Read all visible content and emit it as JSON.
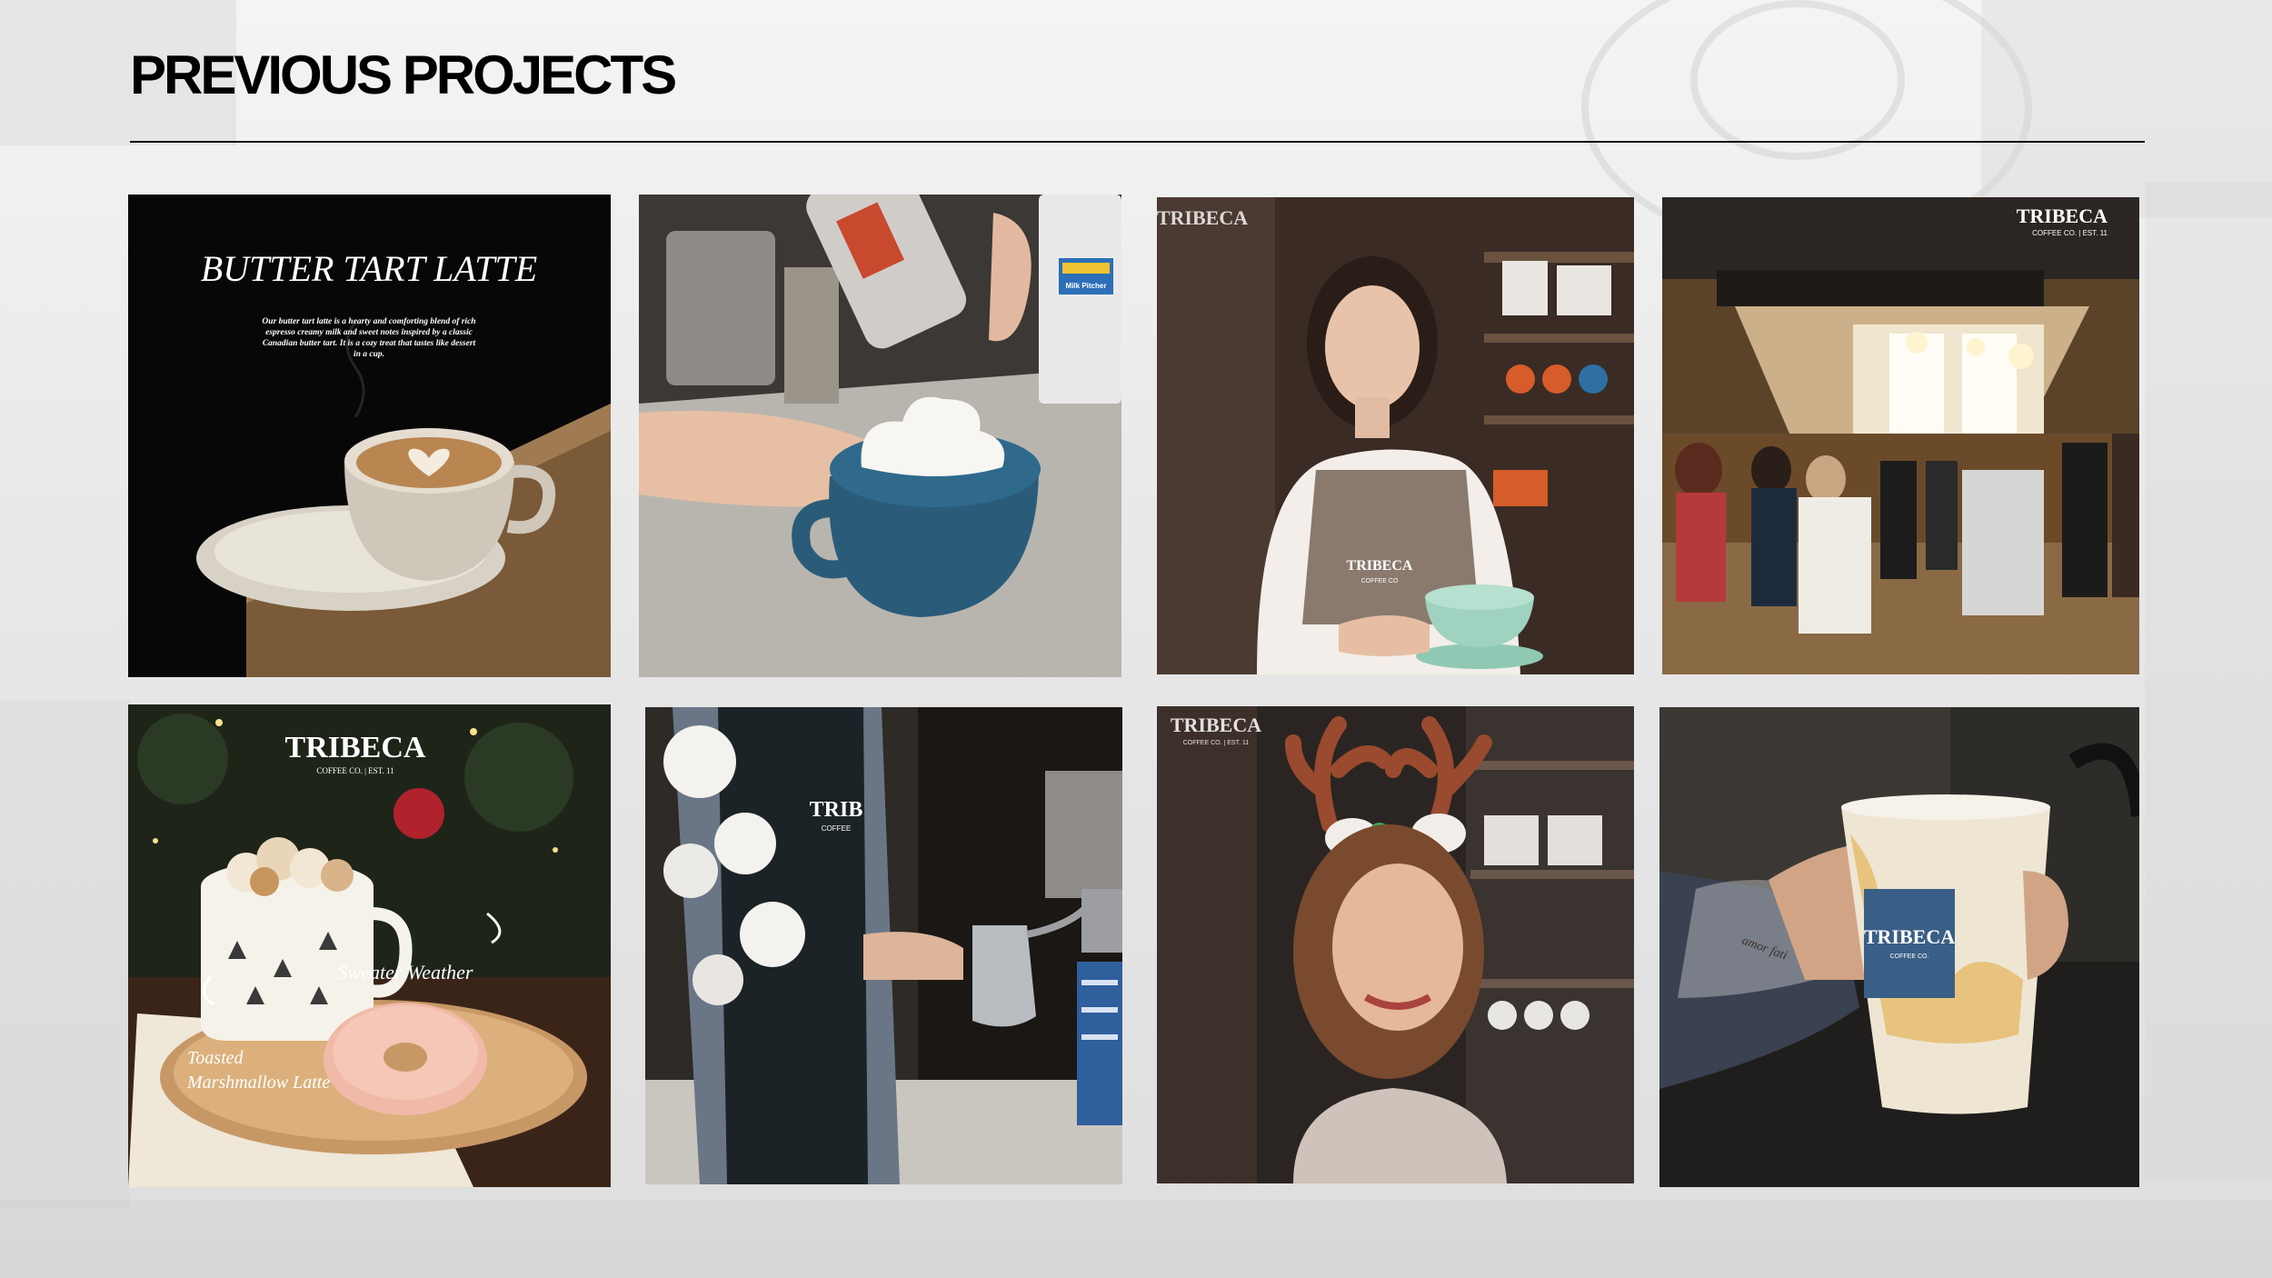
{
  "page": {
    "title": "PREVIOUS PROJECTS"
  },
  "tiles": {
    "butter": {
      "heading": "BUTTER TART LATTE",
      "body": "Our butter tart latte is a hearty and comforting blend of rich espresso creamy milk and sweet notes inspired by a classic Canadian butter tart. It is a cozy treat that tastes like dessert in a cup.",
      "body_lines": [
        "Our butter tart latte is a hearty and comforting blend of rich",
        "espresso creamy milk and sweet notes inspired by a classic",
        "Canadian butter tart. It is a cozy treat that tastes like dessert",
        "in a cup."
      ]
    },
    "whipped": {
      "pitcher_label": "Milk Pitcher"
    },
    "barista": {
      "brand": "TRIBECA",
      "apron": "TRIBECA",
      "apron_sub": "COFFEE CO"
    },
    "interior": {
      "brand": "TRIBECA",
      "sub": "COFFEE CO. | EST. 11"
    },
    "marshmallow": {
      "brand": "TRIBECA",
      "sub": "COFFEE CO. | EST. 11",
      "label_left_1": "Toasted",
      "label_left_2": "Marshmallow Latte",
      "label_right": "Sweater Weather"
    },
    "steaming": {
      "apron": "TRIB",
      "apron_sub": "COFFEE"
    },
    "reindeer": {
      "brand": "TRIBECA",
      "sub": "COFFEE CO. | EST. 11"
    },
    "iced": {
      "cup_brand": "TRIBECA",
      "cup_sub": "COFFEE CO.",
      "tattoo": "amor fati"
    }
  },
  "colors": {
    "dark_bg": "#0a0a0a",
    "cream": "#e8dccb",
    "teal_cup": "#2f5f7a",
    "mint_cup": "#9fd3bf",
    "apron": "#8a7a6e",
    "wood": "#8b6a45"
  }
}
